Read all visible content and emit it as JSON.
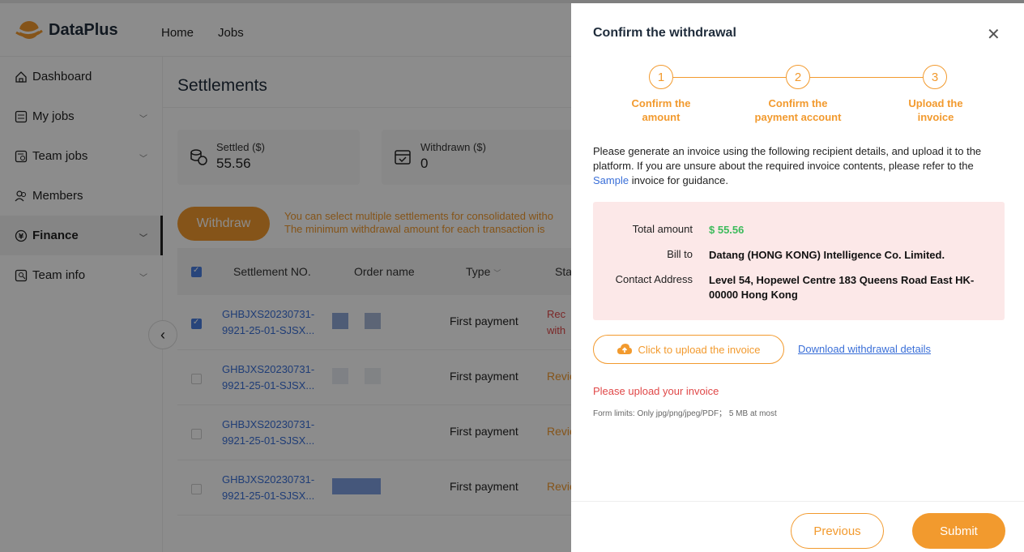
{
  "app": {
    "logo_text": "DataPlus"
  },
  "topnav": {
    "items": [
      {
        "label": "Home"
      },
      {
        "label": "Jobs"
      }
    ]
  },
  "sidebar": {
    "items": [
      {
        "label": "Dashboard",
        "icon": "home-icon"
      },
      {
        "label": "My jobs",
        "icon": "jobs-icon"
      },
      {
        "label": "Team jobs",
        "icon": "team-jobs-icon"
      },
      {
        "label": "Members",
        "icon": "members-icon"
      },
      {
        "label": "Finance",
        "icon": "finance-icon",
        "active": true
      },
      {
        "label": "Team info",
        "icon": "team-info-icon"
      }
    ]
  },
  "main": {
    "title": "Settlements",
    "cards": [
      {
        "label": "Settled ($)",
        "value": "55.56",
        "icon": "coins-icon"
      },
      {
        "label": "Withdrawn ($)",
        "value": "0",
        "icon": "wallet-icon"
      }
    ],
    "withdraw_label": "Withdraw",
    "notice_line1": "You can select multiple settlements for consolidated witho",
    "notice_line2": "The minimum withdrawal amount for each transaction is",
    "columns": {
      "settlement_no": "Settlement NO.",
      "order_name": "Order name",
      "type": "Type",
      "status": "Sta"
    },
    "rows": [
      {
        "sn1": "GHBJXS20230731-",
        "sn2": "9921-25-01-SJSX...",
        "type": "First payment",
        "status1": "Rec",
        "status2": "with",
        "checked": true
      },
      {
        "sn1": "GHBJXS20230731-",
        "sn2": "9921-25-01-SJSX...",
        "type": "First payment",
        "status1": "Revie",
        "checked": false
      },
      {
        "sn1": "GHBJXS20230731-",
        "sn2": "9921-25-01-SJSX...",
        "type": "First payment",
        "status1": "Revie",
        "checked": false
      },
      {
        "sn1": "GHBJXS20230731-",
        "sn2": "9921-25-01-SJSX...",
        "type": "First payment",
        "status1": "Revie",
        "checked": false
      }
    ]
  },
  "drawer": {
    "title": "Confirm the withdrawal",
    "steps": [
      {
        "num": "1",
        "label1": "Confirm the",
        "label2": "amount"
      },
      {
        "num": "2",
        "label1": "Confirm the",
        "label2": "payment account"
      },
      {
        "num": "3",
        "label1": "Upload the",
        "label2": "invoice"
      }
    ],
    "desc_part1": "Please generate an invoice using the following recipient details, and upload it to the platform. If you are unsure about the required invoice contents, please refer to the ",
    "desc_link": "Sample",
    "desc_part2": " invoice for guidance.",
    "info": {
      "total_label": "Total amount",
      "total_value": "$ 55.56",
      "bill_label": "Bill to",
      "bill_value": "Datang (HONG KONG) Intelligence Co. Limited.",
      "address_label": "Contact Address",
      "address_value": "Level 54, Hopewel Centre 183 Queens Road East HK-00000 Hong Kong"
    },
    "upload_label": "Click to upload the invoice",
    "download_label": "Download withdrawal details",
    "error_text": "Please upload your invoice",
    "limits_text": "Form limits: Only jpg/png/jpeg/PDF； 5 MB at most",
    "previous_label": "Previous",
    "submit_label": "Submit"
  },
  "colors": {
    "accent": "#f29a2e",
    "link": "#3a6fd8",
    "error": "#e04848",
    "success": "#3dbb5c"
  }
}
